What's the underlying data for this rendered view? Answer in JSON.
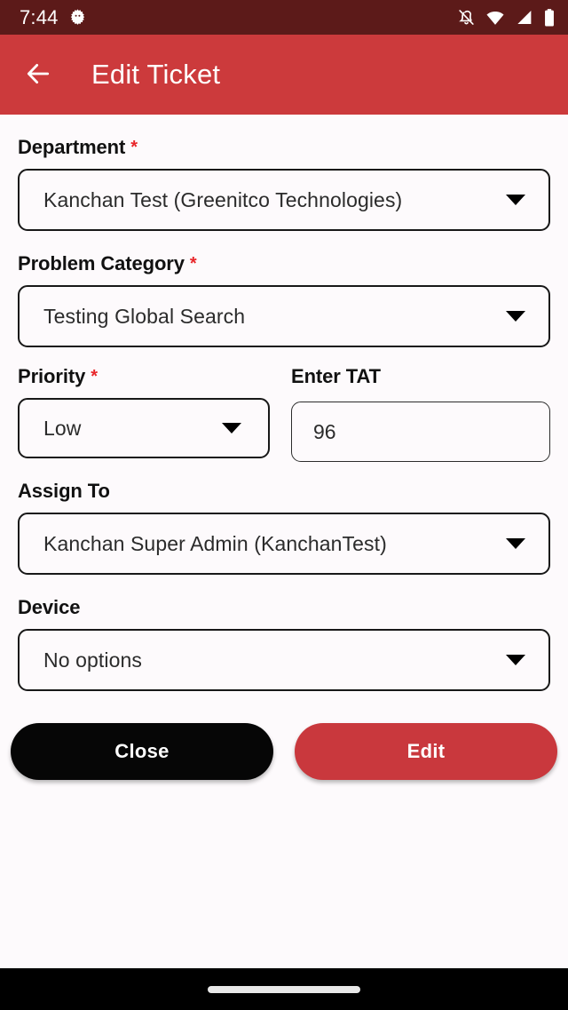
{
  "status_bar": {
    "time": "7:44",
    "icons": [
      "bug-gear-icon",
      "notifications-off-icon",
      "wifi-icon",
      "cellular-signal-icon",
      "battery-icon"
    ],
    "background_color": "#5C1A19"
  },
  "app_bar": {
    "title": "Edit Ticket",
    "back_icon": "arrow-back-icon",
    "background_color": "#CC3A3C"
  },
  "form": {
    "department": {
      "label": "Department",
      "required": true,
      "value": "Kanchan Test (Greenitco Technologies)"
    },
    "problem_category": {
      "label": "Problem Category",
      "required": true,
      "value": "Testing Global Search"
    },
    "priority": {
      "label": "Priority",
      "required": true,
      "value": "Low"
    },
    "tat": {
      "label": "Enter TAT",
      "required": false,
      "value": "96",
      "placeholder": "Enter TAT"
    },
    "assign_to": {
      "label": "Assign To",
      "required": false,
      "value": "Kanchan Super Admin (KanchanTest)"
    },
    "device": {
      "label": "Device",
      "required": false,
      "value": "No options"
    },
    "required_marker": "*",
    "required_marker_color": "#E8262A"
  },
  "actions": {
    "close_label": "Close",
    "close_color": "#060606",
    "edit_label": "Edit",
    "edit_color": "#C9383D"
  },
  "nav_bar": {
    "handle": "gesture-pill",
    "background_color": "#000000"
  }
}
